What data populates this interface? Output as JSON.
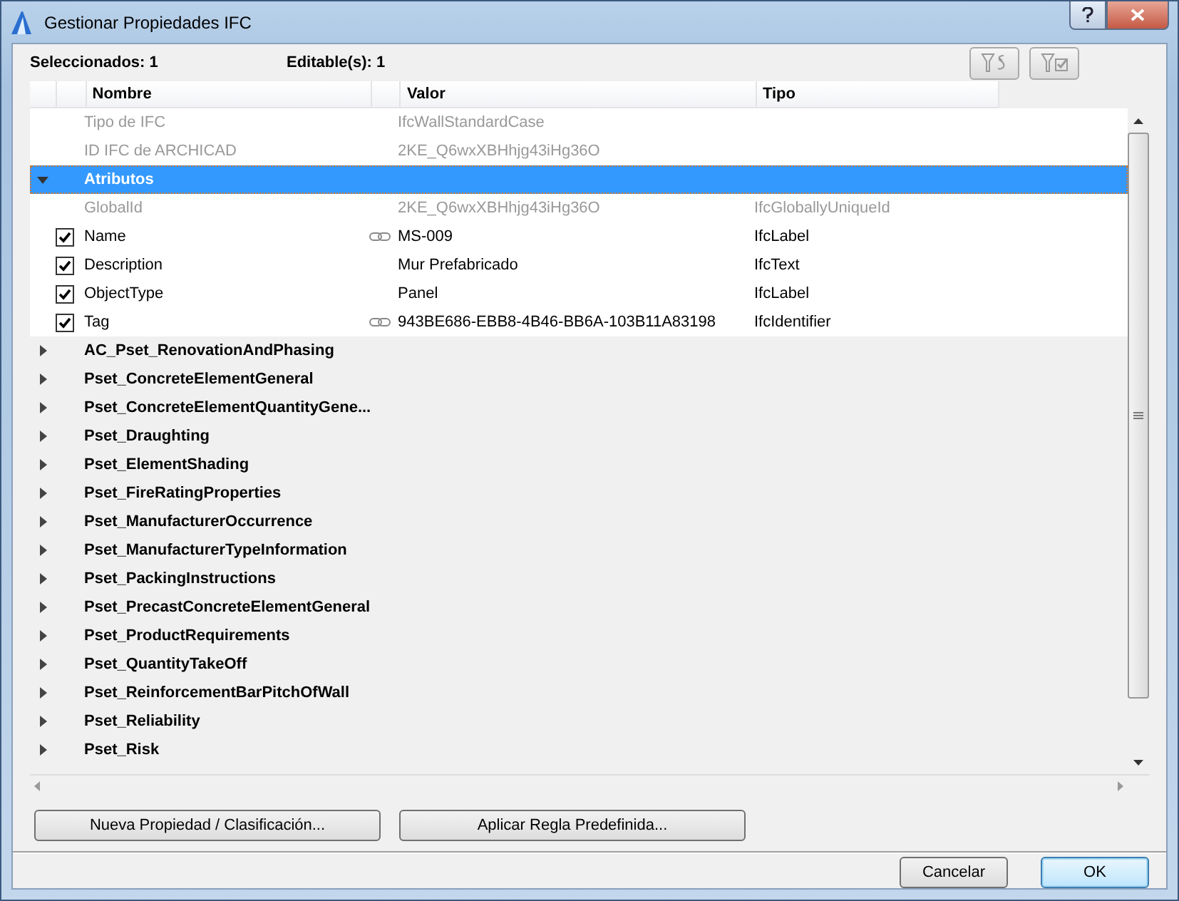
{
  "window": {
    "title": "Gestionar Propiedades IFC"
  },
  "summary": {
    "selected": "Seleccionados: 1",
    "editable": "Editable(s): 1"
  },
  "table": {
    "columns": [
      "Nombre",
      "Valor",
      "Tipo"
    ],
    "info_rows": [
      {
        "name": "Tipo de IFC",
        "value": "IfcWallStandardCase"
      },
      {
        "name": "ID IFC de ARCHICAD",
        "value": "2KE_Q6wxXBHhjg43iHg36O"
      }
    ],
    "groups": [
      {
        "name": "Atributos",
        "expanded": true,
        "selected": true,
        "children": [
          {
            "kind": "info",
            "name": "GlobalId",
            "value": "2KE_Q6wxXBHhjg43iHg36O",
            "type": "IfcGloballyUniqueId"
          },
          {
            "kind": "property",
            "checked": true,
            "linked": true,
            "name": "Name",
            "value": "MS-009",
            "type": "IfcLabel"
          },
          {
            "kind": "property",
            "checked": true,
            "linked": false,
            "name": "Description",
            "value": "Mur Prefabricado",
            "type": "IfcText"
          },
          {
            "kind": "property",
            "checked": true,
            "linked": false,
            "name": "ObjectType",
            "value": "Panel",
            "type": "IfcLabel"
          },
          {
            "kind": "property",
            "checked": true,
            "linked": true,
            "name": "Tag",
            "value": "943BE686-EBB8-4B46-BB6A-103B11A83198",
            "type": "IfcIdentifier"
          }
        ]
      },
      {
        "name": "AC_Pset_RenovationAndPhasing",
        "expanded": false,
        "selected": false
      },
      {
        "name": "Pset_ConcreteElementGeneral",
        "expanded": false,
        "selected": false
      },
      {
        "name": "Pset_ConcreteElementQuantityGene...",
        "expanded": false,
        "selected": false
      },
      {
        "name": "Pset_Draughting",
        "expanded": false,
        "selected": false
      },
      {
        "name": "Pset_ElementShading",
        "expanded": false,
        "selected": false
      },
      {
        "name": "Pset_FireRatingProperties",
        "expanded": false,
        "selected": false
      },
      {
        "name": "Pset_ManufacturerOccurrence",
        "expanded": false,
        "selected": false
      },
      {
        "name": "Pset_ManufacturerTypeInformation",
        "expanded": false,
        "selected": false
      },
      {
        "name": "Pset_PackingInstructions",
        "expanded": false,
        "selected": false
      },
      {
        "name": "Pset_PrecastConcreteElementGeneral",
        "expanded": false,
        "selected": false
      },
      {
        "name": "Pset_ProductRequirements",
        "expanded": false,
        "selected": false
      },
      {
        "name": "Pset_QuantityTakeOff",
        "expanded": false,
        "selected": false
      },
      {
        "name": "Pset_ReinforcementBarPitchOfWall",
        "expanded": false,
        "selected": false
      },
      {
        "name": "Pset_Reliability",
        "expanded": false,
        "selected": false
      },
      {
        "name": "Pset_Risk",
        "expanded": false,
        "selected": false
      }
    ]
  },
  "actions": [
    "Nueva Propiedad / Clasificación...",
    "Aplicar Regla Predefinida..."
  ],
  "buttons": [
    {
      "label": "Cancelar",
      "default": false
    },
    {
      "label": "OK",
      "default": true
    }
  ]
}
